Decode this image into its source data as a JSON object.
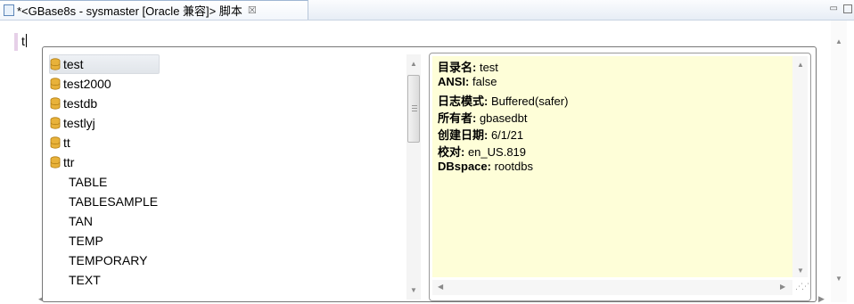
{
  "tab": {
    "title": "*<GBase8s - sysmaster [Oracle 兼容]> 脚本",
    "close_glyph": "☒",
    "minimize_glyph": "▭"
  },
  "editor": {
    "typed_text": "t"
  },
  "completion": {
    "items": [
      {
        "label": "test",
        "icon": "database-icon",
        "selected": true
      },
      {
        "label": "test2000",
        "icon": "database-icon"
      },
      {
        "label": "testdb",
        "icon": "database-icon"
      },
      {
        "label": "testlyj",
        "icon": "database-icon"
      },
      {
        "label": "tt",
        "icon": "database-icon"
      },
      {
        "label": "ttr",
        "icon": "database-icon"
      },
      {
        "label": "TABLE"
      },
      {
        "label": "TABLESAMPLE"
      },
      {
        "label": "TAN"
      },
      {
        "label": "TEMP"
      },
      {
        "label": "TEMPORARY"
      },
      {
        "label": "TEXT"
      }
    ]
  },
  "details": {
    "lines": [
      {
        "key": "目录名:",
        "value": " test"
      },
      {
        "key": "ANSI:",
        "value": " false"
      },
      {
        "key": "日志模式:",
        "value": " Buffered(safer)"
      },
      {
        "key": "所有者:",
        "value": " gbasedbt"
      },
      {
        "key": "创建日期:",
        "value": " 6/1/21"
      },
      {
        "key": "校对:",
        "value": " en_US.819"
      },
      {
        "key": "DBspace:",
        "value": " rootdbs"
      }
    ]
  },
  "colors": {
    "detail_background": "#fefed8",
    "selection": "#e4e8ee",
    "db_icon": "#e8b23a"
  }
}
